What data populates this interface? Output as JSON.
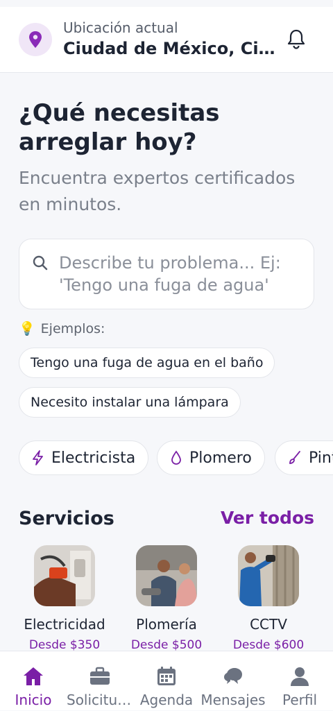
{
  "header": {
    "location_label": "Ubicación actual",
    "city": "Ciudad de México, Ciudad de México",
    "icons": [
      "location-pin-icon",
      "bell-icon"
    ]
  },
  "hero": {
    "title": "¿Qué necesitas arreglar hoy?",
    "subtitle": "Encuentra expertos certificados en minutos."
  },
  "search": {
    "placeholder": "Describe tu problema... Ej: 'Tengo una fuga de agua'"
  },
  "examples": {
    "label": "Ejemplos:",
    "icon": "lightbulb-icon",
    "items": [
      "Tengo una fuga de agua en el baño",
      "Necesito instalar una lámpara"
    ]
  },
  "categories": [
    {
      "label": "Electricista",
      "icon": "bolt-icon"
    },
    {
      "label": "Plomero",
      "icon": "drop-icon"
    },
    {
      "label": "Pintor",
      "icon": "brush-icon"
    }
  ],
  "services": {
    "title": "Servicios",
    "see_all": "Ver todos",
    "items": [
      {
        "name": "Electricidad",
        "price": "Desde $350"
      },
      {
        "name": "Plomería",
        "price": "Desde $500"
      },
      {
        "name": "CCTV",
        "price": "Desde $600"
      }
    ]
  },
  "nav": {
    "items": [
      {
        "label": "Inicio",
        "icon": "home-icon",
        "active": true
      },
      {
        "label": "Solicitudes",
        "icon": "briefcase-icon"
      },
      {
        "label": "Agenda",
        "icon": "calendar-icon"
      },
      {
        "label": "Mensajes",
        "icon": "chat-icon"
      },
      {
        "label": "Perfil",
        "icon": "user-icon"
      }
    ]
  },
  "colors": {
    "accent": "#7a1fa6",
    "background": "#f6f7fa"
  }
}
